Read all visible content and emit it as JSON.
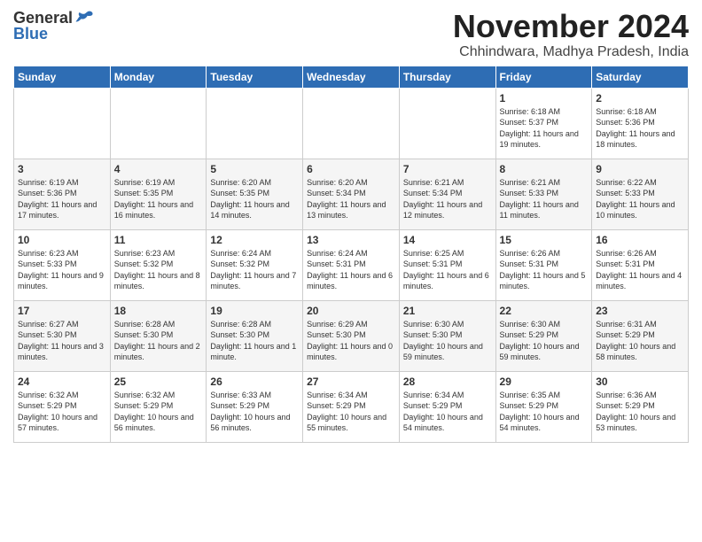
{
  "header": {
    "logo_general": "General",
    "logo_blue": "Blue",
    "month_title": "November 2024",
    "location": "Chhindwara, Madhya Pradesh, India"
  },
  "days_of_week": [
    "Sunday",
    "Monday",
    "Tuesday",
    "Wednesday",
    "Thursday",
    "Friday",
    "Saturday"
  ],
  "weeks": [
    [
      {
        "day": "",
        "info": ""
      },
      {
        "day": "",
        "info": ""
      },
      {
        "day": "",
        "info": ""
      },
      {
        "day": "",
        "info": ""
      },
      {
        "day": "",
        "info": ""
      },
      {
        "day": "1",
        "info": "Sunrise: 6:18 AM\nSunset: 5:37 PM\nDaylight: 11 hours and 19 minutes."
      },
      {
        "day": "2",
        "info": "Sunrise: 6:18 AM\nSunset: 5:36 PM\nDaylight: 11 hours and 18 minutes."
      }
    ],
    [
      {
        "day": "3",
        "info": "Sunrise: 6:19 AM\nSunset: 5:36 PM\nDaylight: 11 hours and 17 minutes."
      },
      {
        "day": "4",
        "info": "Sunrise: 6:19 AM\nSunset: 5:35 PM\nDaylight: 11 hours and 16 minutes."
      },
      {
        "day": "5",
        "info": "Sunrise: 6:20 AM\nSunset: 5:35 PM\nDaylight: 11 hours and 14 minutes."
      },
      {
        "day": "6",
        "info": "Sunrise: 6:20 AM\nSunset: 5:34 PM\nDaylight: 11 hours and 13 minutes."
      },
      {
        "day": "7",
        "info": "Sunrise: 6:21 AM\nSunset: 5:34 PM\nDaylight: 11 hours and 12 minutes."
      },
      {
        "day": "8",
        "info": "Sunrise: 6:21 AM\nSunset: 5:33 PM\nDaylight: 11 hours and 11 minutes."
      },
      {
        "day": "9",
        "info": "Sunrise: 6:22 AM\nSunset: 5:33 PM\nDaylight: 11 hours and 10 minutes."
      }
    ],
    [
      {
        "day": "10",
        "info": "Sunrise: 6:23 AM\nSunset: 5:33 PM\nDaylight: 11 hours and 9 minutes."
      },
      {
        "day": "11",
        "info": "Sunrise: 6:23 AM\nSunset: 5:32 PM\nDaylight: 11 hours and 8 minutes."
      },
      {
        "day": "12",
        "info": "Sunrise: 6:24 AM\nSunset: 5:32 PM\nDaylight: 11 hours and 7 minutes."
      },
      {
        "day": "13",
        "info": "Sunrise: 6:24 AM\nSunset: 5:31 PM\nDaylight: 11 hours and 6 minutes."
      },
      {
        "day": "14",
        "info": "Sunrise: 6:25 AM\nSunset: 5:31 PM\nDaylight: 11 hours and 6 minutes."
      },
      {
        "day": "15",
        "info": "Sunrise: 6:26 AM\nSunset: 5:31 PM\nDaylight: 11 hours and 5 minutes."
      },
      {
        "day": "16",
        "info": "Sunrise: 6:26 AM\nSunset: 5:31 PM\nDaylight: 11 hours and 4 minutes."
      }
    ],
    [
      {
        "day": "17",
        "info": "Sunrise: 6:27 AM\nSunset: 5:30 PM\nDaylight: 11 hours and 3 minutes."
      },
      {
        "day": "18",
        "info": "Sunrise: 6:28 AM\nSunset: 5:30 PM\nDaylight: 11 hours and 2 minutes."
      },
      {
        "day": "19",
        "info": "Sunrise: 6:28 AM\nSunset: 5:30 PM\nDaylight: 11 hours and 1 minute."
      },
      {
        "day": "20",
        "info": "Sunrise: 6:29 AM\nSunset: 5:30 PM\nDaylight: 11 hours and 0 minutes."
      },
      {
        "day": "21",
        "info": "Sunrise: 6:30 AM\nSunset: 5:30 PM\nDaylight: 10 hours and 59 minutes."
      },
      {
        "day": "22",
        "info": "Sunrise: 6:30 AM\nSunset: 5:29 PM\nDaylight: 10 hours and 59 minutes."
      },
      {
        "day": "23",
        "info": "Sunrise: 6:31 AM\nSunset: 5:29 PM\nDaylight: 10 hours and 58 minutes."
      }
    ],
    [
      {
        "day": "24",
        "info": "Sunrise: 6:32 AM\nSunset: 5:29 PM\nDaylight: 10 hours and 57 minutes."
      },
      {
        "day": "25",
        "info": "Sunrise: 6:32 AM\nSunset: 5:29 PM\nDaylight: 10 hours and 56 minutes."
      },
      {
        "day": "26",
        "info": "Sunrise: 6:33 AM\nSunset: 5:29 PM\nDaylight: 10 hours and 56 minutes."
      },
      {
        "day": "27",
        "info": "Sunrise: 6:34 AM\nSunset: 5:29 PM\nDaylight: 10 hours and 55 minutes."
      },
      {
        "day": "28",
        "info": "Sunrise: 6:34 AM\nSunset: 5:29 PM\nDaylight: 10 hours and 54 minutes."
      },
      {
        "day": "29",
        "info": "Sunrise: 6:35 AM\nSunset: 5:29 PM\nDaylight: 10 hours and 54 minutes."
      },
      {
        "day": "30",
        "info": "Sunrise: 6:36 AM\nSunset: 5:29 PM\nDaylight: 10 hours and 53 minutes."
      }
    ]
  ]
}
